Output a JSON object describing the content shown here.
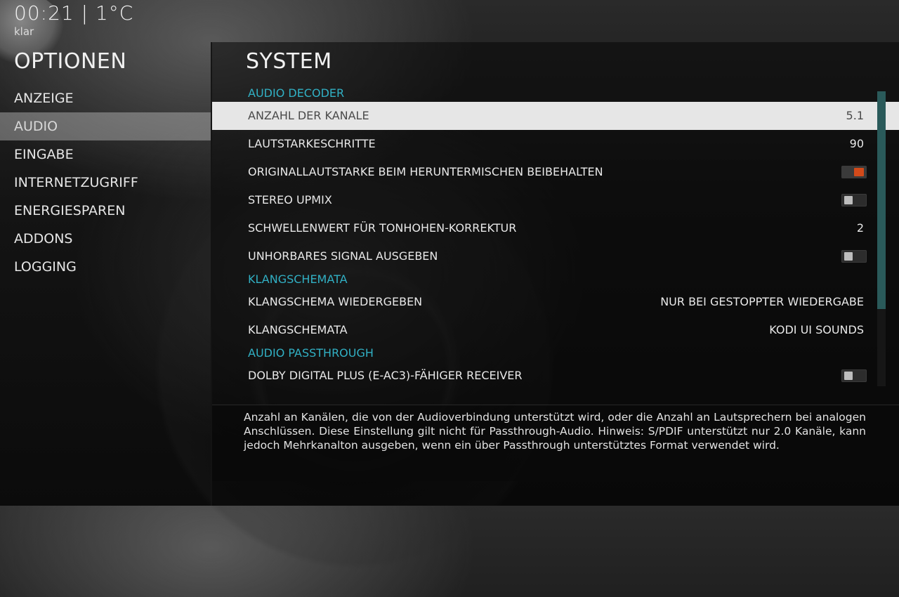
{
  "header": {
    "clock": "00:21 | 1°C",
    "weather": "klar",
    "section_title": "OPTIONEN",
    "panel_title": "SYSTEM"
  },
  "left_menu": {
    "items": [
      {
        "label": "ANZEIGE",
        "selected": false
      },
      {
        "label": "AUDIO",
        "selected": true
      },
      {
        "label": "EINGABE",
        "selected": false
      },
      {
        "label": "INTERNETZUGRIFF",
        "selected": false
      },
      {
        "label": "ENERGIESPAREN",
        "selected": false
      },
      {
        "label": "ADDONS",
        "selected": false
      },
      {
        "label": "LOGGING",
        "selected": false
      }
    ]
  },
  "settings": {
    "section_audio_decoder": "AUDIO DECODER",
    "channels_label": "ANZAHL DER KANALE",
    "channels_value": "5.1",
    "volume_steps_label": "LAUTSTARKESCHRITTE",
    "volume_steps_value": "90",
    "keep_volume_label": "ORIGINALLAUTSTARKE BEIM HERUNTERMISCHEN BEIBEHALTEN",
    "keep_volume_on": true,
    "stereo_upmix_label": "STEREO UPMIX",
    "stereo_upmix_on": false,
    "pitch_threshold_label": "SCHWELLENWERT FÜR TONHOHEN-KORREKTUR",
    "pitch_threshold_value": "2",
    "inaudible_signal_label": "UNHORBARES SIGNAL AUSGEBEN",
    "inaudible_signal_on": false,
    "section_sound_schemes": "KLANGSCHEMATA",
    "play_scheme_label": "KLANGSCHEMA WIEDERGEBEN",
    "play_scheme_value": "NUR BEI GESTOPPTER WIEDERGABE",
    "schemes_label": "KLANGSCHEMATA",
    "schemes_value": "KODI UI SOUNDS",
    "section_passthrough": "AUDIO PASSTHROUGH",
    "eac3_label": "DOLBY DIGITAL PLUS (E-AC3)-FÄHIGER RECEIVER",
    "eac3_on": false
  },
  "description": "Anzahl an Kanälen, die von der Audioverbindung unterstützt wird, oder die Anzahl an Lautsprechern bei analogen Anschlüssen. Diese Einstellung gilt nicht für Passthrough-Audio. Hinweis: S/PDIF unterstützt nur 2.0 Kanäle, kann jedoch Mehrkanalton ausgeben, wenn ein über Passthrough unterstütztes Format verwendet wird.",
  "colors": {
    "section_accent": "#31b0c4",
    "toggle_on": "#d24a1a",
    "selected_row_bg": "#e6e6e6"
  }
}
